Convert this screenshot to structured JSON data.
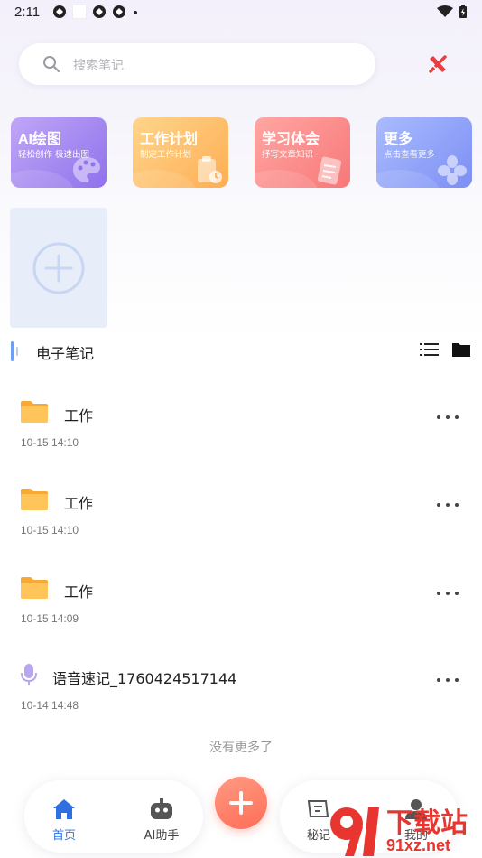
{
  "status_bar": {
    "time": "2:11"
  },
  "search": {
    "placeholder": "搜索笔记"
  },
  "feature_cards": [
    {
      "title": "AI绘图",
      "subtitle": "轻松创作 极速出图",
      "color_start": "#b79bf5",
      "color_end": "#8f74ee"
    },
    {
      "title": "工作计划",
      "subtitle": "制定工作计划",
      "color_start": "#ffd27e",
      "color_end": "#fdb15b"
    },
    {
      "title": "学习体会",
      "subtitle": "抒写文章知识",
      "color_start": "#ff9e9a",
      "color_end": "#f87c7d"
    },
    {
      "title": "更多",
      "subtitle": "点击查看更多",
      "color_start": "#a3b5ff",
      "color_end": "#7f93f5"
    }
  ],
  "section": {
    "title": "电子笔记"
  },
  "notes": [
    {
      "type": "folder",
      "title": "工作",
      "date": "10-15 14:10"
    },
    {
      "type": "folder",
      "title": "工作",
      "date": "10-15 14:10"
    },
    {
      "type": "folder",
      "title": "工作",
      "date": "10-15 14:09"
    },
    {
      "type": "voice",
      "title": "语音速记_1760424517144",
      "date": "10-14 14:48"
    }
  ],
  "end_text": "没有更多了",
  "bottom_nav": {
    "home": "首页",
    "ai_assistant": "AI助手",
    "secret": "秘记",
    "mine": "我的"
  },
  "watermark": {
    "text": "下载站",
    "domain": "91xz.net"
  },
  "colors": {
    "accent_blue": "#2f6fe0",
    "fab": "#ff7a62",
    "folder": "#ffbd45"
  }
}
